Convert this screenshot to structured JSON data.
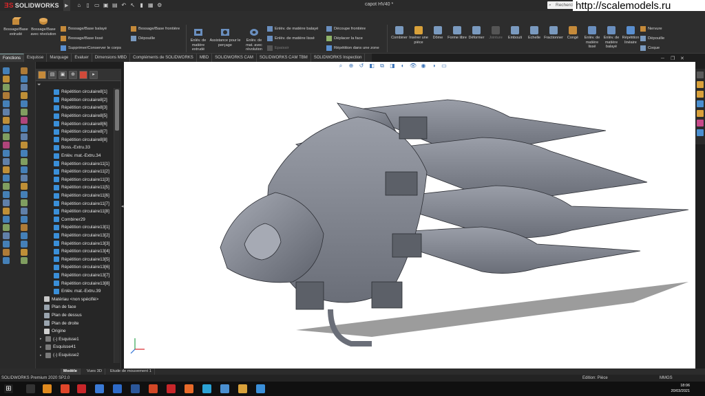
{
  "app": {
    "brand": "SOLIDWORKS",
    "doc_title": "capot HV40 *",
    "search_placeholder": "Recherch",
    "watermark": "http://scalemodels.ru"
  },
  "ribbon": {
    "col1": [
      {
        "label": "Bossage/Base extrudé"
      },
      {
        "label": "Bossage/Base avec révolution"
      }
    ],
    "col1_small": [
      {
        "label": "Bossage/Base balayé"
      },
      {
        "label": "Bossage/Base lissé"
      },
      {
        "label": "Supprimer/Conserver le corps"
      }
    ],
    "col2_small": [
      {
        "label": "Bossage/Base frontière"
      },
      {
        "label": "Dépouille"
      }
    ],
    "col3": [
      {
        "label": "Enlév. de matière extrudé"
      },
      {
        "label": "Assistance pour le perçage"
      },
      {
        "label": "Enlèv. de mat. avec révolution"
      }
    ],
    "col3_small": [
      {
        "label": "Enlèv. de matière balayé",
        "disabled": false
      },
      {
        "label": "Enlèv. de matière lissé",
        "disabled": false
      },
      {
        "label": "Epaissir",
        "disabled": true
      }
    ],
    "col4_small": [
      {
        "label": "Découpe frontière"
      },
      {
        "label": "Déplacer la face"
      },
      {
        "label": "Répétition dans une zone"
      }
    ],
    "col5": [
      {
        "label": "Combiner",
        "disabled": false
      },
      {
        "label": "Insérer une pièce",
        "disabled": false
      },
      {
        "label": "Dôme",
        "disabled": false
      },
      {
        "label": "Forme libre",
        "disabled": false
      },
      {
        "label": "Déformer",
        "disabled": false
      },
      {
        "label": "Jointure",
        "disabled": true
      },
      {
        "label": "Embouti",
        "disabled": false
      },
      {
        "label": "Echelle",
        "disabled": false
      },
      {
        "label": "Fractionner",
        "disabled": false
      },
      {
        "label": "Congé",
        "disabled": false
      },
      {
        "label": "Enlèv. de matière lissé",
        "disabled": false
      },
      {
        "label": "Enlèv. de matière balayé",
        "disabled": false
      },
      {
        "label": "Répétition linéaire",
        "disabled": false
      }
    ],
    "col6_small": [
      {
        "label": "Nervure"
      },
      {
        "label": "Dépouille"
      },
      {
        "label": "Coque"
      }
    ]
  },
  "tabs": [
    "Fonctions",
    "Esquisse",
    "Marquage",
    "Evaluer",
    "Dimensions MBD",
    "Compléments de SOLIDWORKS",
    "MBD",
    "SOLIDWORKS CAM",
    "SOLIDWORKS CAM TBM",
    "SOLIDWORKS Inspection"
  ],
  "tree": [
    {
      "label": "Répétition circulaire8[1]",
      "type": "pattern"
    },
    {
      "label": "Répétition circulaire8[2]",
      "type": "pattern"
    },
    {
      "label": "Répétition circulaire8[3]",
      "type": "pattern"
    },
    {
      "label": "Répétition circulaire8[5]",
      "type": "pattern"
    },
    {
      "label": "Répétition circulaire8[6]",
      "type": "pattern"
    },
    {
      "label": "Répétition circulaire8[7]",
      "type": "pattern"
    },
    {
      "label": "Répétition circulaire8[8]",
      "type": "pattern"
    },
    {
      "label": "Boss.-Extru.33",
      "type": "boss"
    },
    {
      "label": "Enlèv. mat.-Extru.34",
      "type": "pattern"
    },
    {
      "label": "Répétition circulaire11[1]",
      "type": "pattern"
    },
    {
      "label": "Répétition circulaire11[2]",
      "type": "pattern"
    },
    {
      "label": "Répétition circulaire11[3]",
      "type": "pattern"
    },
    {
      "label": "Répétition circulaire11[5]",
      "type": "pattern"
    },
    {
      "label": "Répétition circulaire11[6]",
      "type": "pattern"
    },
    {
      "label": "Répétition circulaire11[7]",
      "type": "pattern"
    },
    {
      "label": "Répétition circulaire11[8]",
      "type": "pattern"
    },
    {
      "label": "Combiner29",
      "type": "pattern"
    },
    {
      "label": "Répétition circulaire13[1]",
      "type": "pattern"
    },
    {
      "label": "Répétition circulaire13[2]",
      "type": "pattern"
    },
    {
      "label": "Répétition circulaire13[3]",
      "type": "pattern"
    },
    {
      "label": "Répétition circulaire13[4]",
      "type": "pattern"
    },
    {
      "label": "Répétition circulaire13[5]",
      "type": "pattern"
    },
    {
      "label": "Répétition circulaire13[6]",
      "type": "pattern"
    },
    {
      "label": "Répétition circulaire13[7]",
      "type": "pattern"
    },
    {
      "label": "Répétition circulaire13[8]",
      "type": "pattern"
    },
    {
      "label": "Enlèv. mat.-Extru.39",
      "type": "pattern"
    },
    {
      "label": "Matériau <non spécifié>",
      "type": "material"
    },
    {
      "label": "Plan de face",
      "type": "plane"
    },
    {
      "label": "Plan de dessus",
      "type": "plane"
    },
    {
      "label": "Plan de droite",
      "type": "plane"
    },
    {
      "label": "Origine",
      "type": "origin"
    },
    {
      "label": "(-) Esquisse1",
      "type": "sketch"
    },
    {
      "label": "Esquisse41",
      "type": "sketch"
    },
    {
      "label": "(-) Esquisse2",
      "type": "sketch"
    }
  ],
  "bottom_tabs": [
    "Modèle",
    "Vues 3D",
    "Etude de mouvement 1"
  ],
  "status": {
    "product": "SOLIDWORKS Premium 2020 SP2.0",
    "mode": "Edition: Pièce",
    "units": "MMGS"
  },
  "clock": {
    "time": "18:06",
    "date": "20/03/2021"
  },
  "colors": {
    "ribbon_bg": "#2d2d2d",
    "tree_icon": "#3a8fd9",
    "model_gray": "#8a8d96",
    "viewport_bg": "#ffffff"
  }
}
